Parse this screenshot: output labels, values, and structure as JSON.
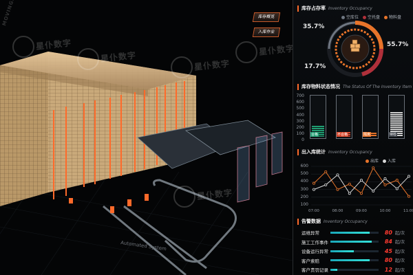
{
  "watermark": {
    "text": "星仆数字",
    "sub": "MOVINGDIGI"
  },
  "buttons": {
    "btn1": "库存概览",
    "btn2": "入库作业"
  },
  "occupancy": {
    "title_zh": "库存占存率",
    "title_en": "Inventory Occupancy",
    "legend": [
      {
        "label": "空库位",
        "color": "#2a2f36"
      },
      {
        "label": "空托盘",
        "color": "#b0303a"
      },
      {
        "label": "物料盘",
        "color": "#e8742a"
      }
    ],
    "values": {
      "left_top": "35.7%",
      "left_bottom": "17.7%",
      "right": "55.7%"
    }
  },
  "status": {
    "title_zh": "库存物料状态情况",
    "title_en": "The Status Of The Inventory Item",
    "yticks": [
      "700",
      "600",
      "500",
      "400",
      "300",
      "200",
      "100",
      "0"
    ],
    "categories": [
      {
        "label": "合格",
        "color": "#1f9e72",
        "level": 0.28
      },
      {
        "label": "不合格",
        "color": "#d9472b",
        "level": 0.12
      },
      {
        "label": "隔离",
        "color": "#e8742a",
        "level": 0.1
      },
      {
        "label": "待检",
        "color": "#cfcfcf",
        "level": 0.62
      }
    ]
  },
  "io_stats": {
    "title_zh": "出入库统计",
    "title_en": "Inventory Occupancy",
    "legend": [
      {
        "label": "出库",
        "color": "#e8742a"
      },
      {
        "label": "入库",
        "color": "#d8d8d8"
      }
    ],
    "yticks": [
      "600",
      "500",
      "400",
      "300",
      "200",
      "100"
    ],
    "xticks": [
      "07:00",
      "08:00",
      "09:00",
      "10:00",
      "11:00"
    ]
  },
  "chart_data": {
    "type": "line",
    "x": [
      "07:00",
      "07:30",
      "08:00",
      "08:30",
      "09:00",
      "09:30",
      "10:00",
      "10:30",
      "11:00"
    ],
    "ylim": [
      100,
      600
    ],
    "series": [
      {
        "name": "出库",
        "color": "#e8742a",
        "values": [
          380,
          530,
          300,
          370,
          250,
          580,
          360,
          420,
          210
        ]
      },
      {
        "name": "入库",
        "color": "#d8d8d8",
        "values": [
          300,
          360,
          490,
          250,
          420,
          280,
          440,
          310,
          470
        ]
      }
    ]
  },
  "alarms": {
    "title_zh": "告警数据",
    "title_en": "Inventory Occupancy",
    "rows": [
      {
        "label": "运维异常",
        "value": "80",
        "unit": "起/次",
        "fill": 0.82
      },
      {
        "label": "施工工作事件",
        "value": "84",
        "unit": "起/次",
        "fill": 0.86
      },
      {
        "label": "设备运行异常",
        "value": "45",
        "unit": "起/次",
        "fill": 0.48
      },
      {
        "label": "客户索赔",
        "value": "80",
        "unit": "起/次",
        "fill": 0.82
      },
      {
        "label": "客户责罚记录",
        "value": "12",
        "unit": "起/次",
        "fill": 0.14
      }
    ]
  }
}
